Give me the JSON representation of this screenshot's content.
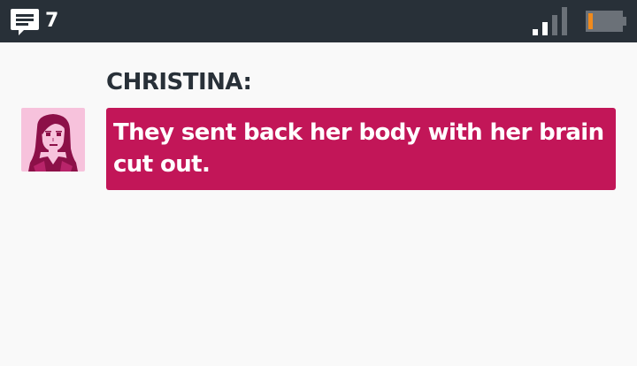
{
  "status_bar": {
    "notification_icon": "message-icon",
    "notification_count": "7",
    "signal_icon": "signal-icon",
    "battery_icon": "battery-icon",
    "battery_level": 0.2,
    "signal_bars_lit": 2,
    "signal_bars_total": 4
  },
  "conversation": {
    "speaker": "CHRISTINA:",
    "avatar_icon": "christina-avatar",
    "message": "They sent back her body with her brain cut out."
  },
  "colors": {
    "status_bar_bg": "#283038",
    "page_bg": "#f9f9f9",
    "bubble_bg": "#c21658",
    "avatar_bg": "#f7c2dc",
    "battery_fill": "#f08a1c"
  }
}
